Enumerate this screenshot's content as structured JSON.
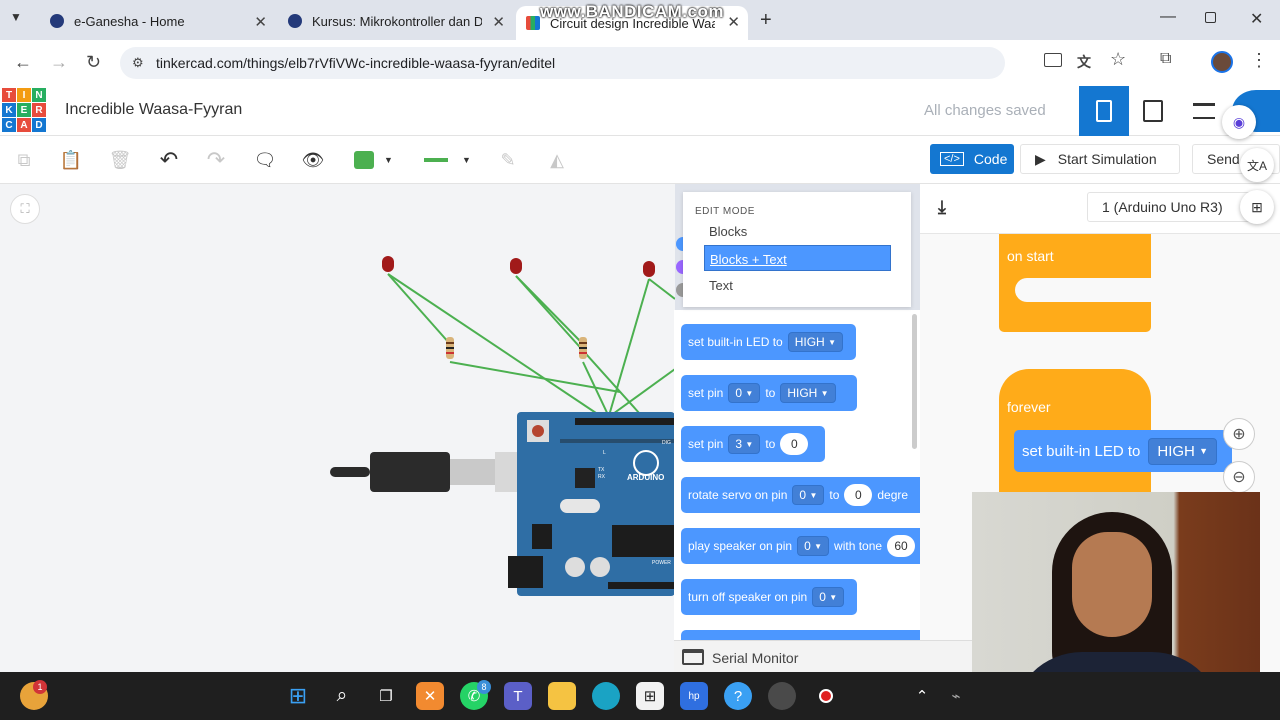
{
  "watermark": "www.BANDICAM.com",
  "browser": {
    "tabs": [
      {
        "title": "e-Ganesha - Home"
      },
      {
        "title": "Kursus: Mikrokontroller dan Da"
      },
      {
        "title": "Circuit design Incredible Waas"
      }
    ],
    "url": "tinkercad.com/things/elb7rVfiVWc-incredible-waasa-fyyran/editel"
  },
  "app": {
    "logo_letters": [
      "T",
      "I",
      "N",
      "K",
      "E",
      "R",
      "C",
      "A",
      "D"
    ],
    "project_title": "Incredible Waasa-Fyyran",
    "save_status": "All changes saved"
  },
  "toolbar": {
    "code_label": "Code",
    "start_sim_label": "Start Simulation",
    "send_label": "Send"
  },
  "code_panel": {
    "device": "1 (Arduino Uno R3)",
    "edit_mode_header": "EDIT MODE",
    "edit_modes": [
      "Blocks",
      "Blocks + Text",
      "Text"
    ],
    "selected_mode": "Blocks + Text",
    "serial_monitor": "Serial Monitor"
  },
  "palette": {
    "b1": {
      "text": "set built-in LED to",
      "value": "HIGH"
    },
    "b2": {
      "t1": "set pin",
      "pin": "0",
      "t2": "to",
      "value": "HIGH"
    },
    "b3": {
      "t1": "set pin",
      "pin": "3",
      "t2": "to",
      "value": "0"
    },
    "b4": {
      "t1": "rotate servo on pin",
      "pin": "0",
      "t2": "to",
      "value": "0",
      "t3": "degre"
    },
    "b5": {
      "t1": "play speaker on pin",
      "pin": "0",
      "t2": "with tone",
      "value": "60"
    },
    "b6": {
      "t1": "turn off speaker on pin",
      "pin": "0"
    }
  },
  "workspace": {
    "on_start": "on start",
    "forever": "forever",
    "inner_block": "set built-in LED to",
    "inner_value": "HIGH"
  },
  "board": {
    "label": "ARDUINO",
    "tx": "TX",
    "rx": "RX",
    "l": "L",
    "power": "POWER",
    "dig": "DIG"
  },
  "taskbar": {
    "notification_count": "1",
    "whatsapp_badge": "8"
  },
  "colors": {
    "tinkercad_blue": "#1477d1",
    "block_blue": "#4c97ff",
    "event_orange": "#ffab19",
    "wire_green": "#4cb050",
    "led_red": "#a11a1a"
  }
}
